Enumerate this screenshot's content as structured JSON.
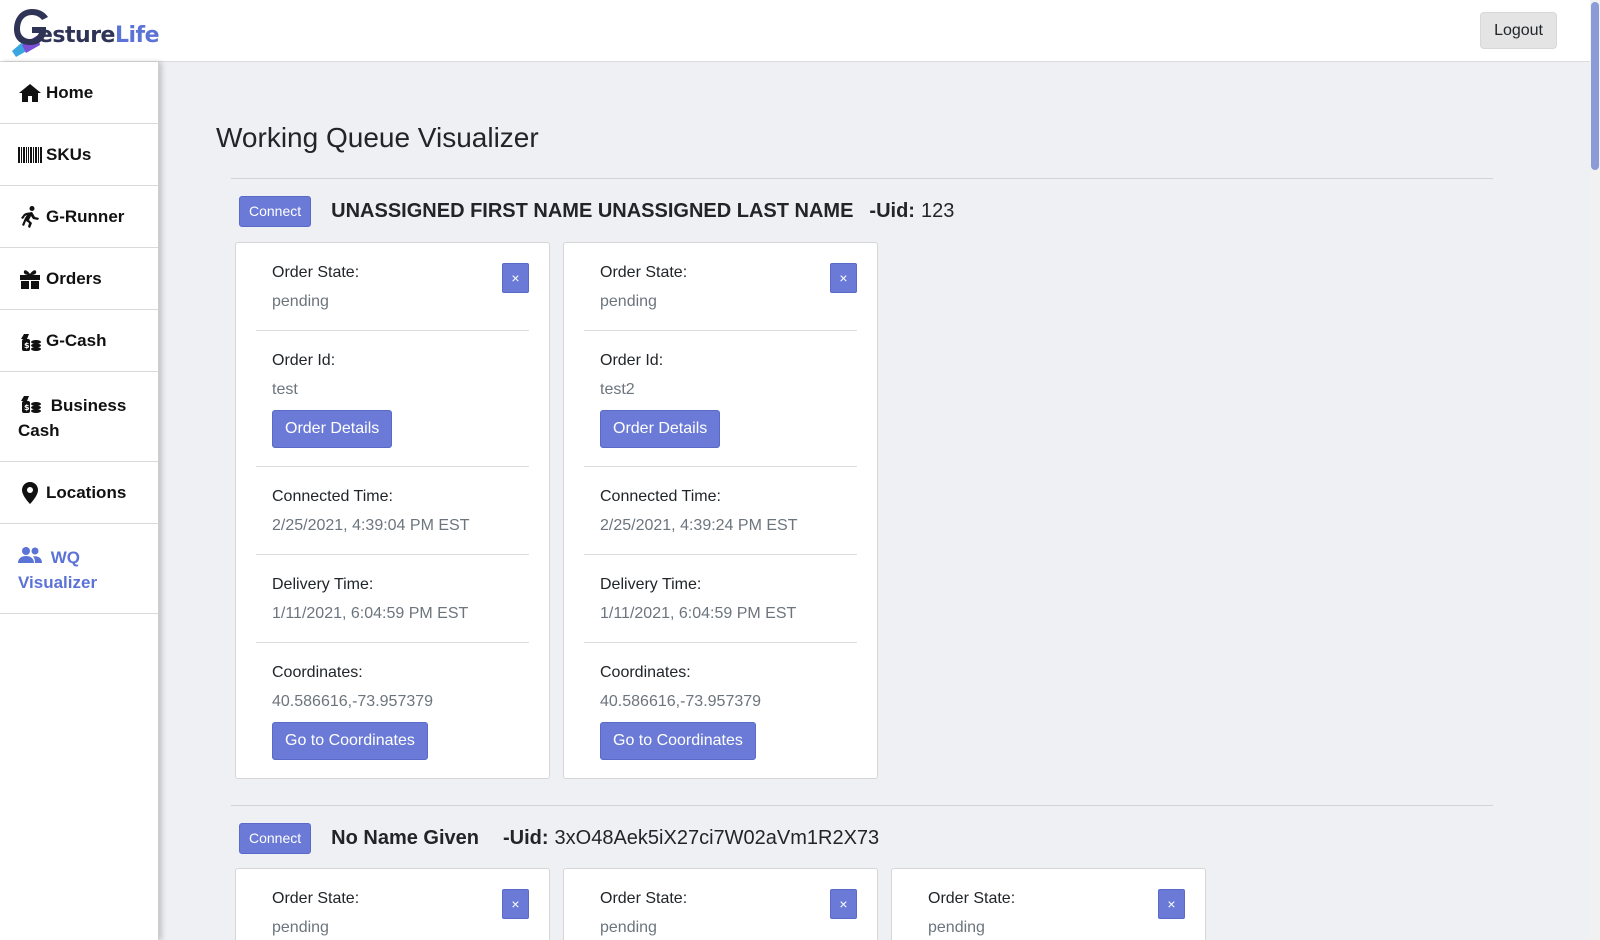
{
  "header": {
    "logo_text_1": "esture",
    "logo_text_2": "Life",
    "logout_label": "Logout"
  },
  "sidebar": {
    "items": [
      {
        "label": "Home",
        "icon": "home-icon"
      },
      {
        "label": "SKUs",
        "icon": "barcode-icon"
      },
      {
        "label": "G-Runner",
        "icon": "runner-icon"
      },
      {
        "label": "Orders",
        "icon": "gift-icon"
      },
      {
        "label": "G-Cash",
        "icon": "money-icon"
      },
      {
        "label": "Business Cash",
        "icon": "money-icon"
      },
      {
        "label": "Locations",
        "icon": "map-pin-icon"
      },
      {
        "label": "WQ Visualizer",
        "icon": "users-icon",
        "active": true
      }
    ]
  },
  "page": {
    "title": "Working Queue Visualizer"
  },
  "labels": {
    "connect": "Connect",
    "uid": "-Uid:",
    "order_state": "Order State:",
    "order_id": "Order Id:",
    "connected_time": "Connected Time:",
    "delivery_time": "Delivery Time:",
    "coordinates": "Coordinates:",
    "order_details": "Order Details",
    "go_to_coordinates": "Go to Coordinates",
    "close": "×"
  },
  "groups": [
    {
      "name": "UNASSIGNED FIRST NAME UNASSIGNED LAST NAME",
      "uid": "123",
      "orders": [
        {
          "state": "pending",
          "id": "test",
          "connected": "2/25/2021, 4:39:04 PM EST",
          "delivery": "1/11/2021, 6:04:59 PM EST",
          "coordinates": "40.586616,-73.957379"
        },
        {
          "state": "pending",
          "id": "test2",
          "connected": "2/25/2021, 4:39:24 PM EST",
          "delivery": "1/11/2021, 6:04:59 PM EST",
          "coordinates": "40.586616,-73.957379"
        }
      ]
    },
    {
      "name": "No Name Given",
      "uid": "3xO48Aek5iX27ci7W02aVm1R2X73",
      "orders": [
        {
          "state": "pending"
        },
        {
          "state": "pending"
        },
        {
          "state": "pending"
        }
      ]
    }
  ],
  "colors": {
    "accent": "#6a7ad6",
    "active_nav": "#5b73d6",
    "background": "#eef0f3"
  }
}
